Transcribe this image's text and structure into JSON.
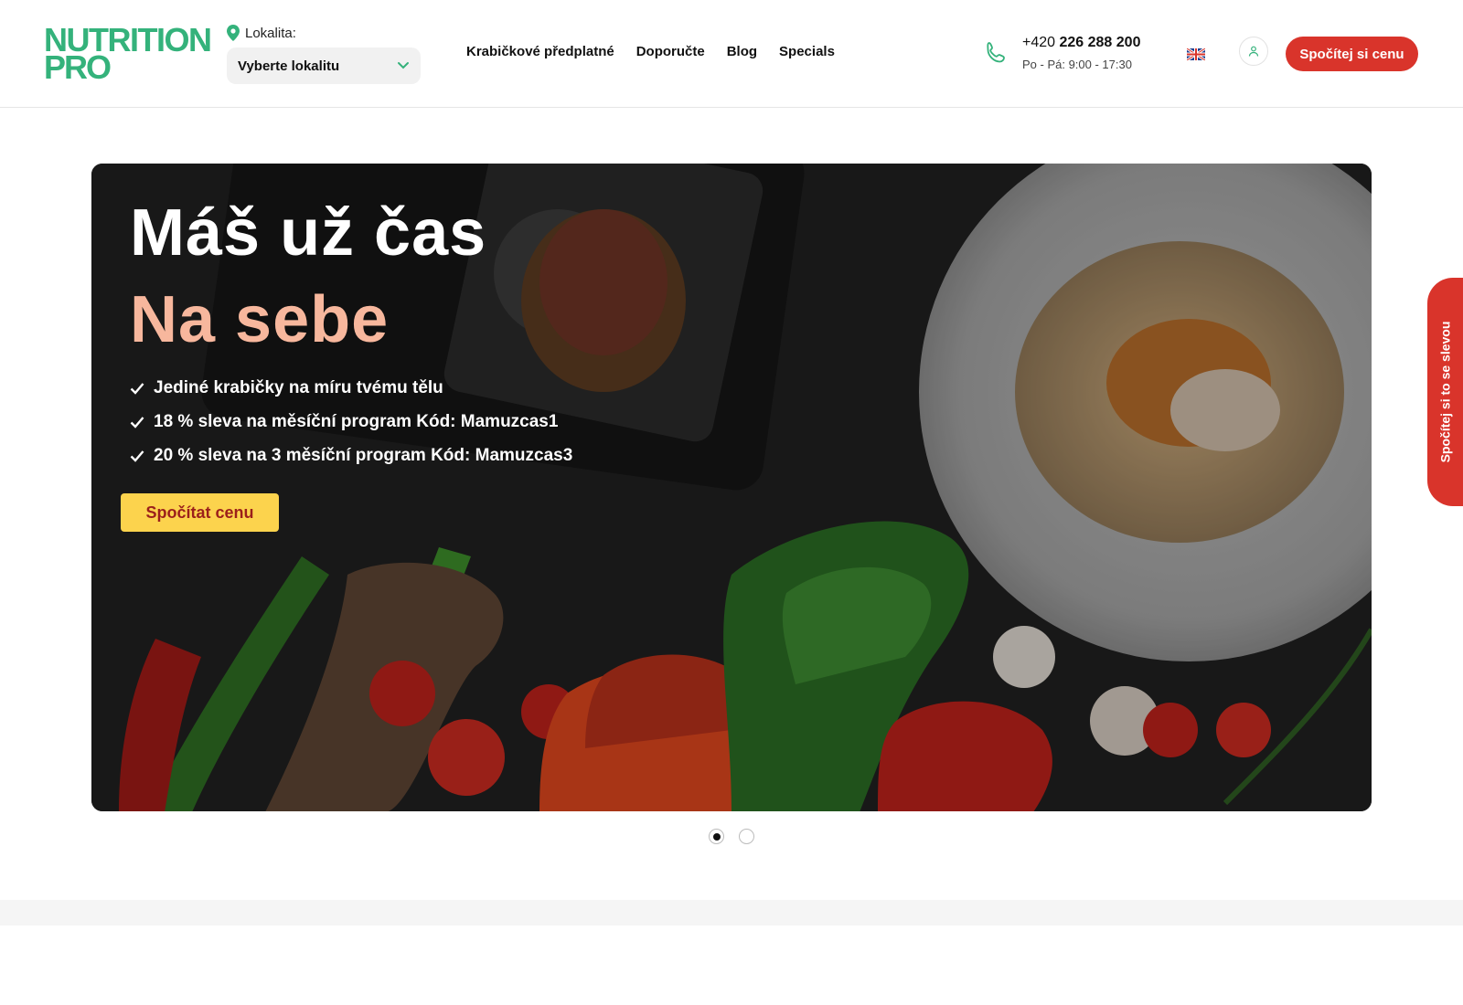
{
  "logo": {
    "line1": "NUTRITION",
    "line2": "PRO"
  },
  "location": {
    "label": "Lokalita:",
    "value": "Vyberte lokalitu"
  },
  "nav": [
    {
      "label": "Krabičkové předplatné"
    },
    {
      "label": "Doporučte"
    },
    {
      "label": "Blog"
    },
    {
      "label": "Specials"
    }
  ],
  "contact": {
    "prefix": "+420 ",
    "number": "226 288 200",
    "hours": "Po - Pá: 9:00 - 17:30"
  },
  "header_cta": "Spočítej si cenu",
  "hero": {
    "title1": "Máš už čas",
    "title2": "Na sebe",
    "bullets": [
      "Jediné krabičky na míru tvému tělu",
      "18 % sleva na měsíční program Kód: Mamuzcas1",
      "20 % sleva na 3 měsíční program Kód: Mamuzcas3"
    ],
    "cta": "Spočítat cenu"
  },
  "carousel": {
    "slides": 2,
    "active": 1
  },
  "side_tab": "Spočítej si to se slevou",
  "colors": {
    "brand_green": "#34b27b",
    "accent_red": "#d9342b",
    "cta_yellow": "#fcd34d",
    "title_peach": "#f7b79d"
  },
  "icons": [
    "location-pin-icon",
    "chevron-down-icon",
    "phone-icon",
    "uk-flag-icon",
    "user-icon",
    "check-icon"
  ]
}
